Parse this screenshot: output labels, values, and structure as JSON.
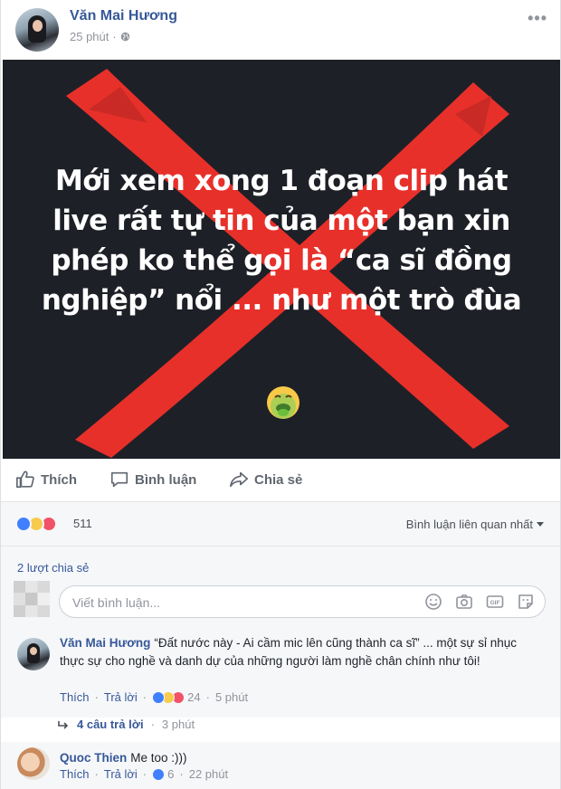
{
  "post": {
    "author": "Văn Mai Hương",
    "time": "25 phút",
    "image_text": [
      "Mới xem xong 1 đoạn clip hát",
      "live rất tự tin của một bạn xin",
      "phép ko thể gọi là “ca sĩ đồng",
      "nghiệp” nổi ... như một trò đùa"
    ],
    "image_emoji": "nauseated-face"
  },
  "actions": {
    "like": "Thích",
    "comment": "Bình luận",
    "share": "Chia sẻ"
  },
  "reactions": {
    "types": [
      "like",
      "haha",
      "love"
    ],
    "count": "511",
    "sort_label": "Bình luận liên quan nhất"
  },
  "shares": {
    "label": "2 lượt chia sẻ"
  },
  "composer": {
    "placeholder": "Viết bình luận..."
  },
  "comments": [
    {
      "author": "Văn Mai Hương",
      "text": "“Đất nước này - Ai cầm mic lên cũng thành ca sĩ” ... một sự sỉ nhục thực sự cho nghề và danh dự của những người làm nghề chân chính như tôi!",
      "like": "Thích",
      "reply": "Trả lời",
      "reaction_count": "24",
      "time": "5 phút",
      "replies_label": "4 câu trả lời",
      "replies_time": "3 phút"
    },
    {
      "author": "Quoc Thien",
      "text": "Me too :)))",
      "like": "Thích",
      "reply": "Trả lời",
      "reaction_count": "6",
      "time": "22 phút"
    }
  ],
  "colors": {
    "link": "#365899",
    "x_mark": "#e8302a",
    "image_bg": "#1e2027"
  }
}
